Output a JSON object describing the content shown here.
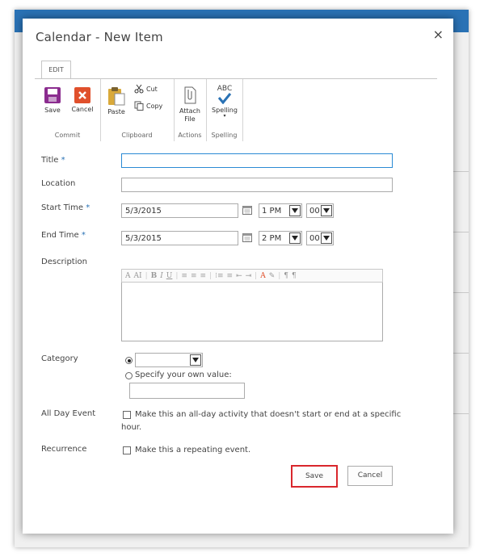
{
  "dialog": {
    "title": "Calendar - New Item",
    "close_glyph": "×"
  },
  "ribbon": {
    "tab": "EDIT",
    "groups": {
      "commit": {
        "label": "Commit",
        "save": "Save",
        "cancel": "Cancel"
      },
      "clipboard": {
        "label": "Clipboard",
        "paste": "Paste",
        "cut": "Cut",
        "copy": "Copy"
      },
      "actions": {
        "label": "Actions",
        "attach_line1": "Attach",
        "attach_line2": "File"
      },
      "spelling": {
        "label": "Spelling",
        "abc": "ABC",
        "spelling": "Spelling"
      }
    }
  },
  "form": {
    "title": {
      "label": "Title",
      "required": "*",
      "value": ""
    },
    "location": {
      "label": "Location",
      "value": ""
    },
    "start_time": {
      "label": "Start Time",
      "required": "*",
      "date": "5/3/2015",
      "hour": "1 PM",
      "minute": "00"
    },
    "end_time": {
      "label": "End Time",
      "required": "*",
      "date": "5/3/2015",
      "hour": "2 PM",
      "minute": "00"
    },
    "description": {
      "label": "Description",
      "toolbar": [
        "A",
        "AI",
        "B",
        "I",
        "U",
        "≡",
        "≡",
        "≡",
        "⁝≡",
        "≡",
        "⇤",
        "⇥",
        "A",
        "✎",
        "¶",
        "¶"
      ]
    },
    "category": {
      "label": "Category",
      "selected": "",
      "own_value_label": "Specify your own value:",
      "own_value": ""
    },
    "all_day": {
      "label": "All Day Event",
      "text_line1": "Make this an all-day activity that doesn't start or end at a specific",
      "text_line2": "hour.",
      "checked": false
    },
    "recurrence": {
      "label": "Recurrence",
      "text": "Make this a repeating event.",
      "checked": false
    }
  },
  "buttons": {
    "save": "Save",
    "cancel": "Cancel"
  },
  "colors": {
    "accent": "#2a72b5",
    "save_highlight": "#d9262c",
    "save_icon": "#8b2c8f",
    "cancel_icon": "#e0502c",
    "check": "#2a72b5"
  },
  "icons": [
    "save-icon",
    "cancel-icon",
    "paste-icon",
    "cut-icon",
    "copy-icon",
    "attach-file-icon",
    "spelling-icon",
    "calendar-icon",
    "close-icon",
    "chevron-down-icon"
  ]
}
